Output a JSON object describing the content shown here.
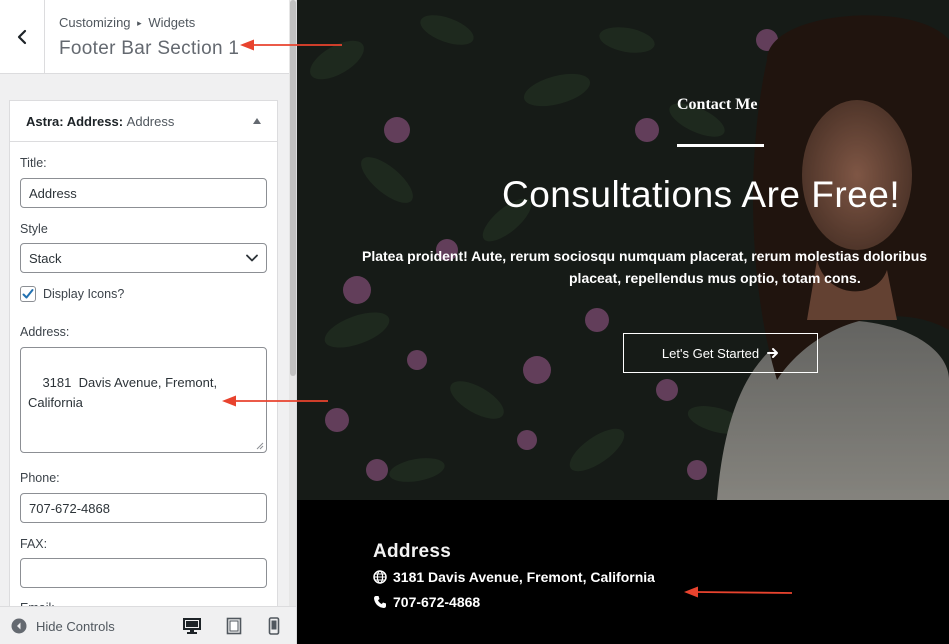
{
  "sidebar": {
    "breadcrumb_root": "Customizing",
    "breadcrumb_sep": "▸",
    "breadcrumb_section": "Widgets",
    "section_title": "Footer Bar Section 1",
    "widget": {
      "title_bold": "Astra: Address:",
      "title_instance": "Address",
      "fields": {
        "title_label": "Title:",
        "title_value": "Address",
        "style_label": "Style",
        "style_value": "Stack",
        "display_icons_label": "Display Icons?",
        "display_icons_checked": true,
        "address_label": "Address:",
        "address_value": "3181  Davis Avenue, Fremont,\nCalifornia",
        "phone_label": "Phone:",
        "phone_value": "707-672-4868",
        "fax_label": "FAX:",
        "fax_value": "",
        "email_label": "Email:"
      }
    },
    "footer": {
      "hide_controls_label": "Hide Controls"
    }
  },
  "preview": {
    "hero": {
      "eyebrow": "Contact Me",
      "heading": "Consultations Are Free!",
      "paragraph_line1": "Platea proident! Aute, rerum sociosqu numquam placerat, rerum molestias doloribus",
      "paragraph_line2": "placeat, repellendus mus optio, totam cons.",
      "cta_label": "Let's Get Started"
    },
    "footer_widget": {
      "title": "Address",
      "address": "3181 Davis Avenue, Fremont, California",
      "phone": "707-672-4868"
    }
  },
  "colors": {
    "annotation_arrow": "#e8432e",
    "footer_bg": "#000000",
    "sidebar_bg": "#f0f0f1",
    "checkbox_tick": "#2271b1"
  },
  "icons": {
    "back": "chevron-left-icon",
    "widget_toggle": "caret-up-icon",
    "select_arrow": "chevron-down-icon",
    "hide_controls": "circle-arrow-left-icon",
    "desktop": "desktop-icon",
    "tablet": "tablet-icon",
    "mobile": "mobile-icon",
    "cta_arrow": "arrow-right-icon",
    "address": "globe-icon",
    "phone": "phone-icon"
  }
}
